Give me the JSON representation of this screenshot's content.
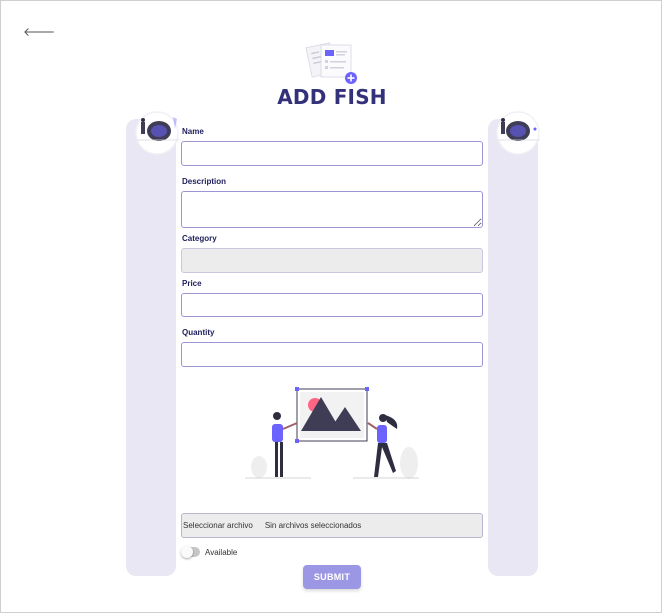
{
  "header": {
    "back_icon": "arrow-left-icon",
    "back_glyph": "🡐",
    "logo_icon": "add-document-icon",
    "title": "ADD FISH"
  },
  "form": {
    "name": {
      "label": "Name",
      "value": ""
    },
    "description": {
      "label": "Description",
      "value": ""
    },
    "category": {
      "label": "Category",
      "value": ""
    },
    "price": {
      "label": "Price",
      "value": ""
    },
    "quantity": {
      "label": "Quantity",
      "value": ""
    },
    "file": {
      "button_label": "Seleccionar archivo",
      "status_text": "Sin archivos seleccionados"
    },
    "available": {
      "label": "Available",
      "checked": false
    },
    "submit_label": "SUBMIT"
  },
  "colors": {
    "title": "#33317a",
    "accent": "#6c63ff",
    "side_panel": "#e9e7f3",
    "submit": "#9c97e4",
    "illustration_red": "#ff6584",
    "illustration_dark": "#3f3d56"
  }
}
